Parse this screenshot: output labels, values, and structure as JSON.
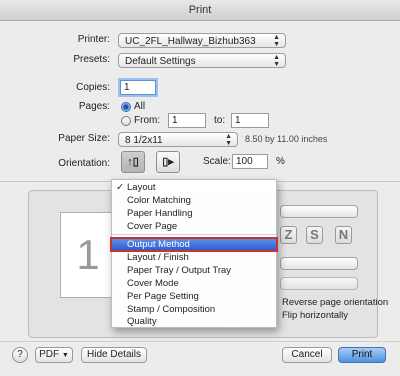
{
  "window": {
    "title": "Print"
  },
  "printer": {
    "label": "Printer:",
    "value": "UC_2FL_Hallway_Bizhub363"
  },
  "presets": {
    "label": "Presets:",
    "value": "Default Settings"
  },
  "copies": {
    "label": "Copies:",
    "value": "1"
  },
  "pages": {
    "label": "Pages:",
    "all_label": "All",
    "from_label": "From:",
    "from_value": "1",
    "to_label": "to:",
    "to_value": "1",
    "selected": "All"
  },
  "paper_size": {
    "label": "Paper Size:",
    "value": "8 1/2x11",
    "hint": "8.50 by 11.00 inches"
  },
  "orientation": {
    "label": "Orientation:",
    "selected": "portrait"
  },
  "scale": {
    "label": "Scale:",
    "value": "100",
    "unit": "%"
  },
  "preview": {
    "page_number": "1"
  },
  "menu": {
    "checked_item": "Layout",
    "items": [
      "Layout",
      "Color Matching",
      "Paper Handling",
      "Cover Page",
      "Output Method",
      "Layout / Finish",
      "Paper Tray / Output Tray",
      "Cover Mode",
      "Per Page Setting",
      "Stamp / Composition",
      "Quality"
    ],
    "highlighted_item": "Output Method"
  },
  "layout_panel": {
    "reverse_label": "Reverse page orientation",
    "flip_label": "Flip horizontally"
  },
  "footer": {
    "help_label": "?",
    "pdf_label": "PDF",
    "hide_details_label": "Hide Details",
    "cancel_label": "Cancel",
    "print_label": "Print"
  },
  "colors": {
    "accent": "#2c5ed6",
    "highlight_outline": "#c0392b"
  }
}
